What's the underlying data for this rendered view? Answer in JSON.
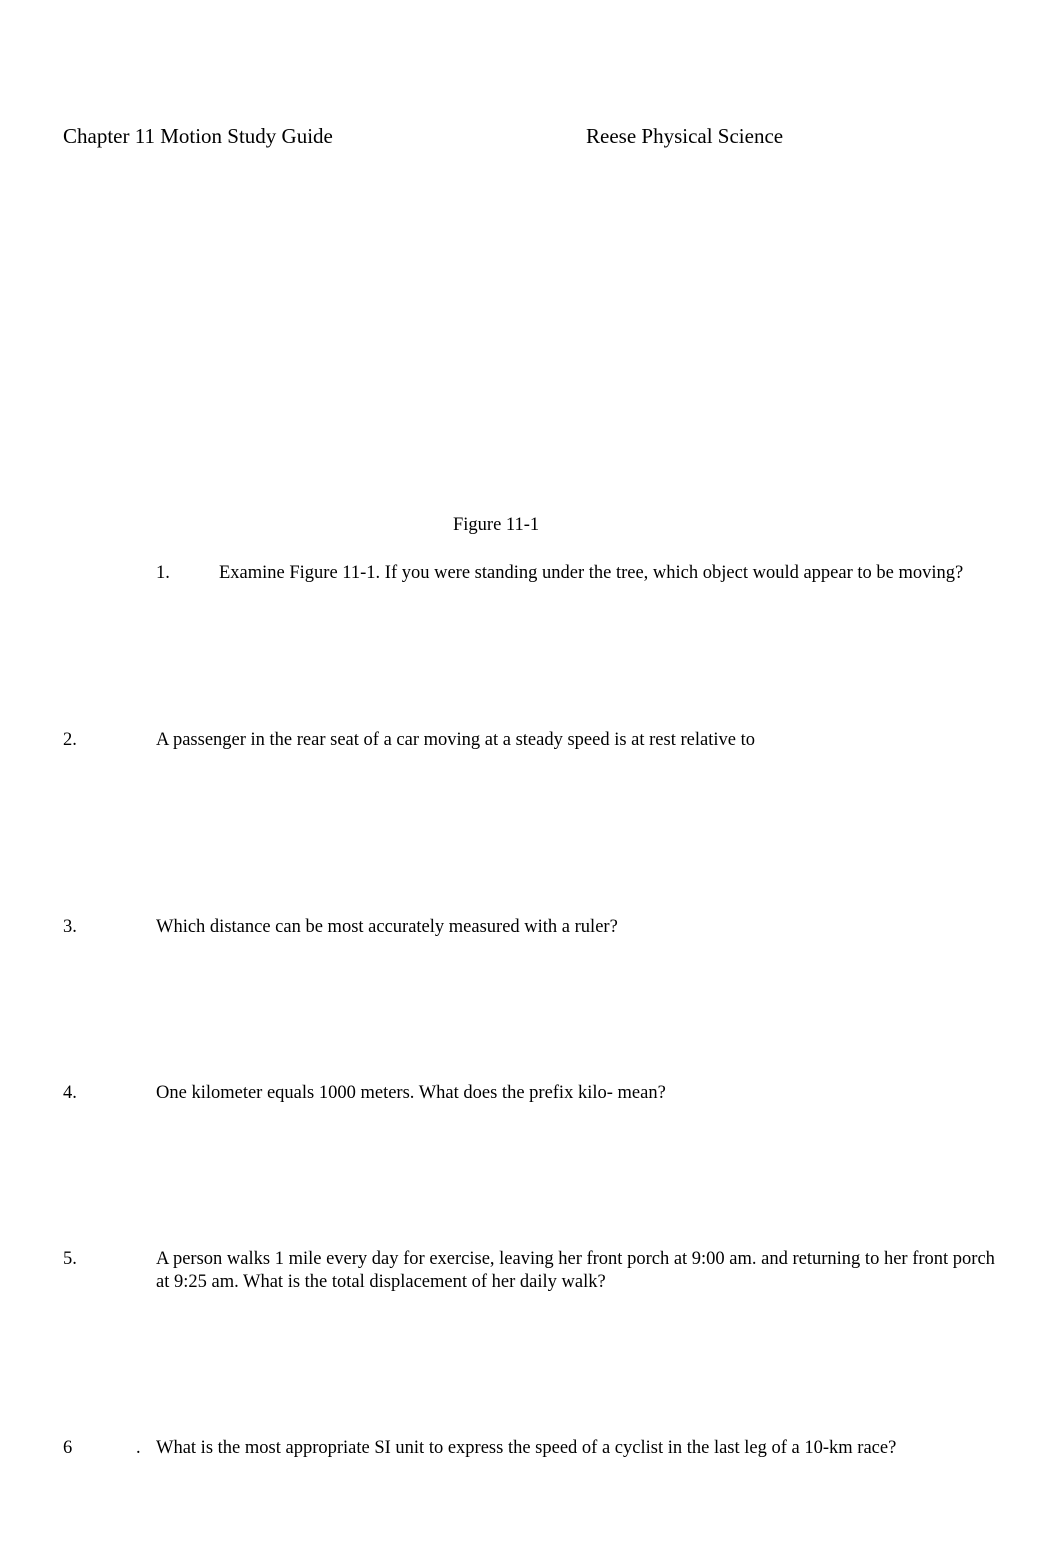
{
  "header": {
    "title": "Chapter 11 Motion Study Guide",
    "course": "Reese Physical Science"
  },
  "figure": {
    "caption": "Figure 11-1"
  },
  "questions": [
    {
      "number": "1.",
      "text": "Examine Figure 11-1. If you were standing under the tree, which object would appear to be moving?"
    },
    {
      "number": "2.",
      "text": "A passenger in the rear seat of a car moving at a steady speed is at rest relative to"
    },
    {
      "number": "3.",
      "text": "Which distance can be most accurately measured with a ruler?"
    },
    {
      "number": "4.",
      "text": "One kilometer equals 1000 meters. What does the prefix kilo- mean?"
    },
    {
      "number": "5.",
      "text": "A person walks 1 mile every day for exercise, leaving her front porch at 9:00 am. and returning to her front porch at 9:25 am. What is the total displacement of her daily walk?"
    },
    {
      "number": "6",
      "dot": ".",
      "text": "What is the most appropriate SI unit to express the speed of a cyclist in the last leg of a 10-km race?"
    }
  ]
}
